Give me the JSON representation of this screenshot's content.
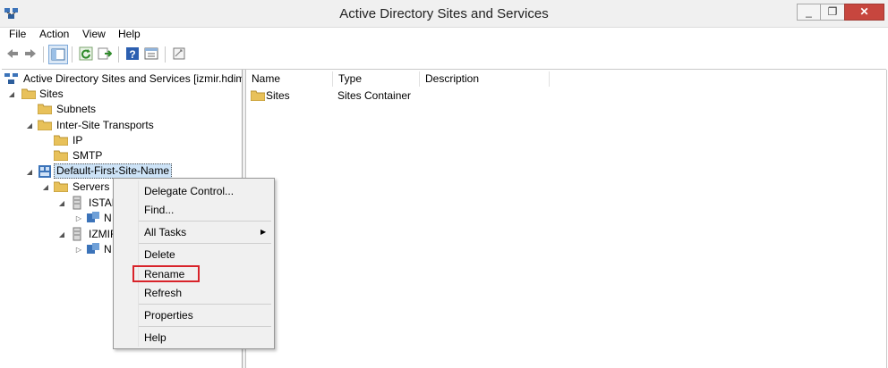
{
  "window": {
    "title": "Active Directory Sites and Services",
    "min_glyph": "_",
    "max_glyph": "❐",
    "close_glyph": "✕"
  },
  "menu": [
    "File",
    "Action",
    "View",
    "Help"
  ],
  "toolbar_icons": [
    "back-arrow-icon",
    "forward-arrow-icon",
    "show-hide-console-tree-icon",
    "refresh-icon",
    "export-list-icon",
    "help-icon",
    "properties-icon",
    "console-icon"
  ],
  "tree": {
    "root": "Active Directory Sites and Services [izmir.hdimd",
    "sites": "Sites",
    "subnets": "Subnets",
    "inter_site_transports": "Inter-Site Transports",
    "ip": "IP",
    "smtp": "SMTP",
    "default_site": "Default-First-Site-Name",
    "servers": "Servers",
    "server1": "ISTAN",
    "server1_child": "N",
    "server2": "IZMIF",
    "server2_child": "N"
  },
  "list": {
    "columns": [
      "Name",
      "Type",
      "Description"
    ],
    "rows": [
      {
        "name": "Sites",
        "type": "Sites Container",
        "description": ""
      }
    ]
  },
  "context_menu": {
    "items": [
      "Delegate Control...",
      "Find...",
      "All Tasks",
      "Delete",
      "Rename",
      "Refresh",
      "Properties",
      "Help"
    ],
    "submenu_arrow": "▶",
    "highlighted": "Rename"
  },
  "colors": {
    "highlight_border": "#d8232a",
    "close_button": "#c7463e",
    "selection": "#cde3f7",
    "folder": "#e8c15a"
  }
}
